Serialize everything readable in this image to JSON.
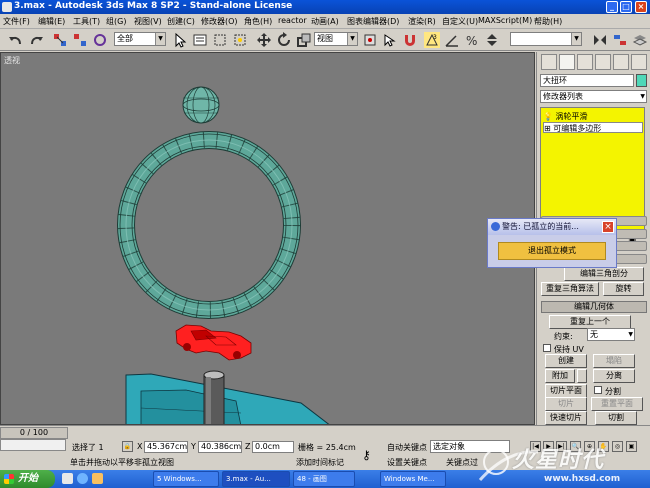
{
  "window": {
    "title": "3.max - Autodesk 3ds Max 8 SP2 - Stand-alone License"
  },
  "menu": {
    "items": [
      "文件(F)",
      "编辑(E)",
      "工具(T)",
      "组(G)",
      "视图(V)",
      "创建(C)",
      "修改器(O)",
      "角色(H)",
      "reactor",
      "动画(A)",
      "图表编辑器(D)",
      "渲染(R)",
      "自定义(U)",
      "MAXScript(M)",
      "帮助(H)"
    ]
  },
  "toolbar": {
    "selection_filter": "全部",
    "reference_coord": "视图"
  },
  "viewport": {
    "label": "透视"
  },
  "command_panel": {
    "object_name": "大扭环",
    "modifier_list": "修改器列表",
    "stack": [
      "涡轮平滑",
      "可编辑多边形"
    ],
    "buttons": {
      "edit_triangulation": "编辑三角剖分",
      "retriangulate": "重复三角算法",
      "turn": "旋转",
      "edit_geometry": "编辑几何体",
      "repeat_last": "重复上一个",
      "constraints_label": "约束:",
      "constraints_value": "无",
      "preserve_uv": "保持 UV",
      "create": "创建",
      "collapse": "塌陷",
      "attach": "附加",
      "detach": "分离",
      "slice_plane": "切片平面",
      "split": "分割",
      "slice": "切片",
      "reset_plane": "重置平面",
      "quickslice": "快速切片",
      "cut": "切割"
    }
  },
  "dialog": {
    "title": "警告: 已孤立的当前...",
    "button": "退出孤立模式"
  },
  "status": {
    "time_slider": "0 / 100",
    "selected": "选择了 1",
    "x": "45.367cm",
    "y": "40.386cm",
    "z": "0.0cm",
    "grid": "栅格 = 25.4cm",
    "prompt": "单击并拖动以平移非孤立视图",
    "add_time_tag": "添加时间标记",
    "auto_key": "自动关键点",
    "set_key": "设置关键点",
    "selected_obj": "选定对象",
    "key_filters": "关键点过"
  },
  "taskbar": {
    "start": "开始",
    "tasks": [
      "5 Windows...",
      "3.max - Au...",
      "48 - 画图",
      "Windows Me..."
    ]
  },
  "watermark": {
    "text": "火星时代",
    "url": "www.hxsd.com"
  },
  "colors": {
    "accent": "#0a53d8",
    "torus": "#5ea89a",
    "car": "#ff2020",
    "box": "#2fa8b8",
    "stack_bg": "#f4f400",
    "dialog_btn": "#f0c040"
  }
}
